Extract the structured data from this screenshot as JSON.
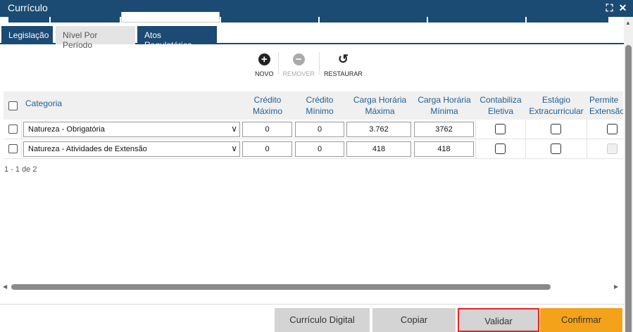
{
  "window": {
    "title": "Currículo"
  },
  "sub_tabs": [
    {
      "label": "Legislação"
    },
    {
      "label": "Nível Por Período"
    },
    {
      "label": "Atos Regulatórios"
    }
  ],
  "toolbar": {
    "new_label": "NOVO",
    "remove_label": "REMOVER",
    "restore_label": "RESTAURAR"
  },
  "grid": {
    "columns": [
      {
        "label": "Categoria"
      },
      {
        "line1": "Crédito",
        "line2": "Máximo"
      },
      {
        "line1": "Crédito",
        "line2": "Mínimo"
      },
      {
        "line1": "Carga Horária",
        "line2": "Máxima"
      },
      {
        "line1": "Carga Horária",
        "line2": "Mínima"
      },
      {
        "line1": "Contabiliza",
        "line2": "Eletiva"
      },
      {
        "line1": "Estágio",
        "line2": "Extracurricular"
      },
      {
        "line1": "Permite",
        "line2": "Extensão"
      }
    ],
    "rows": [
      {
        "categoria": "Natureza - Obrigatória",
        "credito_max": "0",
        "credito_min": "0",
        "carga_max": "3.762",
        "carga_min": "3762"
      },
      {
        "categoria": "Natureza - Atividades de Extensão",
        "credito_max": "0",
        "credito_min": "0",
        "carga_max": "418",
        "carga_min": "418"
      }
    ]
  },
  "pager": {
    "text": "1 - 1 de 2"
  },
  "footer": {
    "digital_label": "Currículo Digital",
    "copy_label": "Copiar",
    "validate_label": "Validar",
    "confirm_label": "Confirmar"
  },
  "colors": {
    "header_blue": "#1b4a72",
    "column_text": "#1f5f94",
    "confirm_orange": "#f5a21b",
    "highlight_red": "#e0242b"
  }
}
